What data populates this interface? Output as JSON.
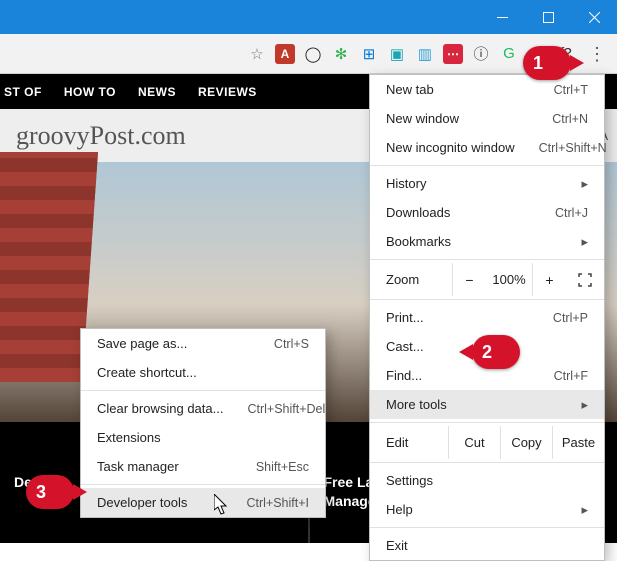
{
  "window": {
    "minimize": "–",
    "maximize": "☐",
    "close": "✕"
  },
  "toolbar_icons": [
    {
      "name": "star-icon",
      "glyph": "☆",
      "color": "#777"
    },
    {
      "name": "acrobat-icon",
      "glyph": "A",
      "color": "#fff",
      "bg": "#c0392b"
    },
    {
      "name": "chat-icon",
      "glyph": "◯",
      "color": "#222"
    },
    {
      "name": "evernote-icon",
      "glyph": "✻",
      "color": "#2bb24c"
    },
    {
      "name": "windows-icon",
      "glyph": "⊞",
      "color": "#0078d7"
    },
    {
      "name": "save-icon",
      "glyph": "▣",
      "color": "#1aa6b7"
    },
    {
      "name": "card-icon",
      "glyph": "▥",
      "color": "#2a9fd6"
    },
    {
      "name": "lastpass-icon",
      "glyph": "⋯",
      "color": "#fff",
      "bg": "#d7263d"
    },
    {
      "name": "info-icon",
      "glyph": "ⓘ",
      "color": "#333"
    },
    {
      "name": "grammar-icon",
      "glyph": "G",
      "color": "#1abc5b"
    },
    {
      "name": "stylish-icon",
      "glyph": "S",
      "color": "#444",
      "italic": true
    },
    {
      "name": "whatfont-icon",
      "glyph": "f?",
      "color": "#333",
      "italic": true
    }
  ],
  "menu_button": "⋮",
  "nav": [
    "ST OF",
    "HOW TO",
    "NEWS",
    "REVIEWS"
  ],
  "site_logo": "groovyPost.com",
  "lat_label": "LA",
  "main_menu": {
    "new_tab": {
      "label": "New tab",
      "shortcut": "Ctrl+T"
    },
    "new_window": {
      "label": "New window",
      "shortcut": "Ctrl+N"
    },
    "new_incognito": {
      "label": "New incognito window",
      "shortcut": "Ctrl+Shift+N"
    },
    "history": {
      "label": "History"
    },
    "downloads": {
      "label": "Downloads",
      "shortcut": "Ctrl+J"
    },
    "bookmarks": {
      "label": "Bookmarks"
    },
    "zoom_label": "Zoom",
    "zoom_out": "−",
    "zoom_value": "100%",
    "zoom_in": "+",
    "print": {
      "label": "Print...",
      "shortcut": "Ctrl+P"
    },
    "cast": {
      "label": "Cast..."
    },
    "find": {
      "label": "Find...",
      "shortcut": "Ctrl+F"
    },
    "more_tools": {
      "label": "More tools"
    },
    "edit_label": "Edit",
    "edit_cut": "Cut",
    "edit_copy": "Copy",
    "edit_paste": "Paste",
    "settings": {
      "label": "Settings"
    },
    "help": {
      "label": "Help"
    },
    "exit": {
      "label": "Exit"
    }
  },
  "submenu": {
    "save_page": {
      "label": "Save page as...",
      "shortcut": "Ctrl+S"
    },
    "create_sc": {
      "label": "Create shortcut..."
    },
    "clear_data": {
      "label": "Clear browsing data...",
      "shortcut": "Ctrl+Shift+Del"
    },
    "extensions": {
      "label": "Extensions"
    },
    "taskmgr": {
      "label": "Task manager",
      "shortcut": "Shift+Esc"
    },
    "devtools": {
      "label": "Developer tools",
      "shortcut": "Ctrl+Shift+I"
    }
  },
  "cards": {
    "left": "Desktop",
    "right": "Free LastPass Alternative Password Managers For All Your Devices"
  },
  "callouts": {
    "c1": "1",
    "c2": "2",
    "c3": "3"
  }
}
